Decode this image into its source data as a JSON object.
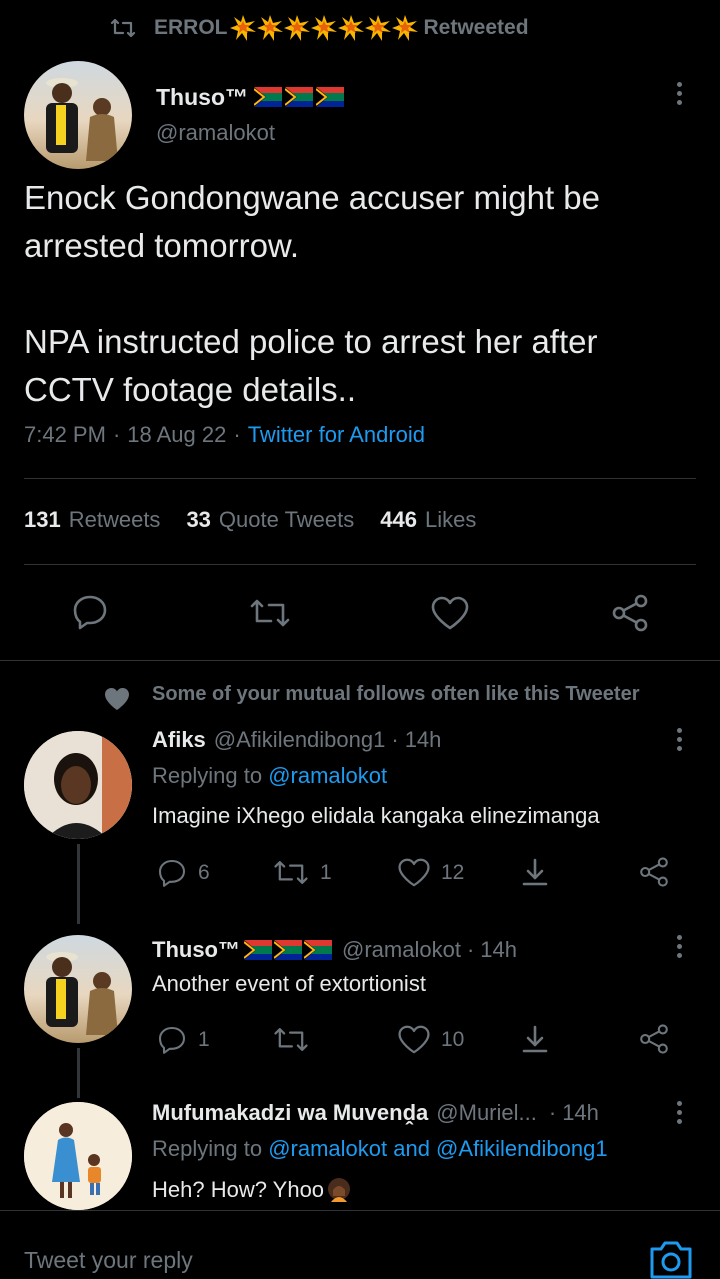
{
  "retweet_banner": {
    "name": "ERROL",
    "suffix": "Retweeted"
  },
  "main_tweet": {
    "display_name": "Thuso™",
    "handle": "@ramalokot",
    "text_lines": [
      "Enock Gondongwane accuser might be",
      "arrested tomorrow.",
      "",
      "NPA instructed police to arrest her after",
      "CCTV footage details.."
    ],
    "time": "7:42 PM",
    "date": "18 Aug 22",
    "source": "Twitter for Android",
    "stats": {
      "retweets_count": "131",
      "retweets_label": "Retweets",
      "quotes_count": "33",
      "quotes_label": "Quote Tweets",
      "likes_count": "446",
      "likes_label": "Likes"
    }
  },
  "social_context": "Some of your mutual follows often like this Tweeter",
  "replies": [
    {
      "display_name": "Afiks",
      "handle": "@Afikilendibong1",
      "time": "14h",
      "replying_prefix": "Replying to",
      "replying_to": "@ramalokot",
      "text": "Imagine iXhego elidala kangaka elinezimanga",
      "reply_count": "6",
      "retweet_count": "1",
      "like_count": "12"
    },
    {
      "display_name": "Thuso™",
      "handle": "@ramalokot",
      "time": "14h",
      "text": "Another event of extortionist",
      "reply_count": "1",
      "retweet_count": "",
      "like_count": "10"
    },
    {
      "display_name": "Mufumakadzi wa Muvenḓa",
      "handle": "@Muriel...",
      "time": "14h",
      "replying_prefix": "Replying to",
      "replying_to": "@ramalokot and @Afikilendibong1",
      "text": "Heh? How? Yhoo"
    }
  ],
  "composer": {
    "placeholder": "Tweet your reply"
  },
  "colors": {
    "accent": "#1d9bf0",
    "muted": "#6e767d",
    "background": "#000000",
    "divider": "#2f3336"
  }
}
